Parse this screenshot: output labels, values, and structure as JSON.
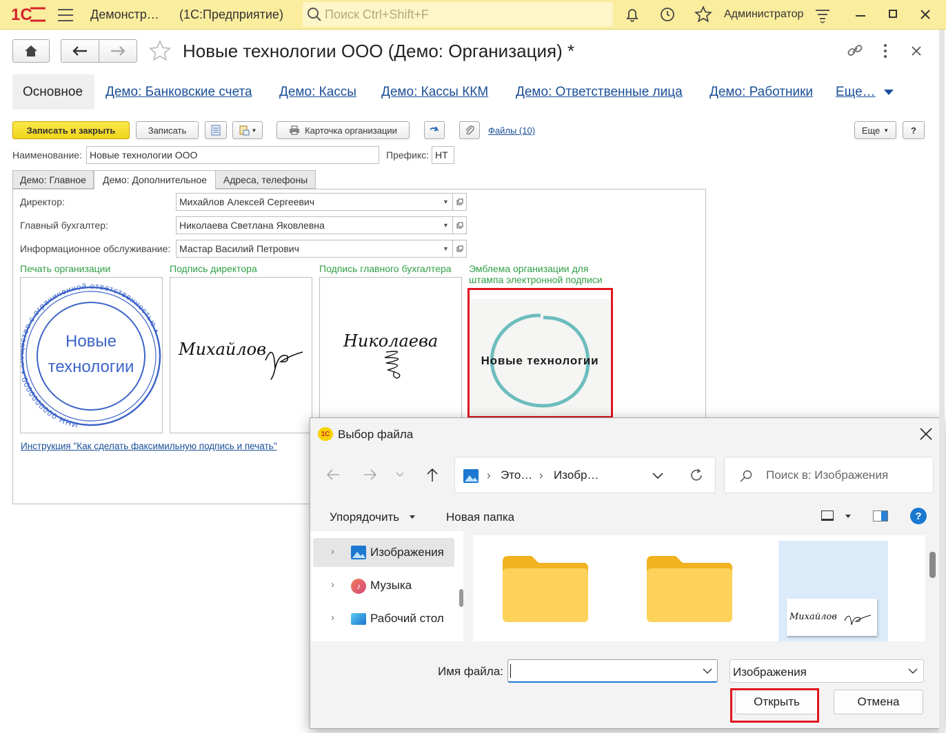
{
  "topbar": {
    "logo": "1С",
    "app_title": "Демонстр…",
    "app_subtitle": "(1С:Предприятие)",
    "search_placeholder": "Поиск Ctrl+Shift+F",
    "user": "Администратор"
  },
  "form": {
    "title": "Новые технологии ООО (Демо: Организация) *",
    "nav_tabs": [
      "Основное",
      "Демо: Банковские счета",
      "Демо: Кассы",
      "Демо: Кассы ККМ",
      "Демо: Ответственные лица",
      "Демо: Работники",
      "Еще…"
    ],
    "toolbar": {
      "save_close": "Записать и закрыть",
      "save": "Записать",
      "card": "Карточка организации",
      "files": "Файлы (10)",
      "more": "Еще",
      "help": "?"
    },
    "name_label": "Наименование:",
    "name_value": "Новые технологии ООО",
    "prefix_label": "Префикс:",
    "prefix_value": "НТ",
    "inner_tabs": [
      "Демо: Главное",
      "Демо: Дополнительное",
      "Адреса, телефоны"
    ],
    "director_label": "Директор:",
    "director_value": "Михайлов Алексей Сергеевич",
    "accountant_label": "Главный бухгалтер:",
    "accountant_value": "Николаева Светлана Яковлевна",
    "info_label": "Информационное обслуживание:",
    "info_value": "Мастар Василий Петрович",
    "seal_label": "Печать организации",
    "director_sign_label": "Подпись директора",
    "accountant_sign_label": "Подпись главного бухгалтера",
    "emblem_label_1": "Эмблема организации для",
    "emblem_label_2": "штампа электронной подписи",
    "seal_text_1": "Новые",
    "seal_text_2": "технологии",
    "seal_ring_text": "ИНН 0000000000 • Общество с ограниченной ответственностью •",
    "director_signature": "Михайлов",
    "accountant_signature": "Николаева",
    "emblem_text": "Новые технологии",
    "instruction_link": "Инструкция \"Как сделать факсимильную подпись и печать\""
  },
  "dialog": {
    "title": "Выбор файла",
    "path_1": "Это…",
    "path_2": "Изобр…",
    "search_placeholder": "Поиск в: Изображения",
    "organize": "Упорядочить",
    "new_folder": "Новая папка",
    "help": "?",
    "tree": [
      "Изображения",
      "Музыка",
      "Рабочий стол"
    ],
    "thumb_signature": "Михайлов",
    "filename_label": "Имя файла:",
    "filename_value": "",
    "filetype": "Изображения",
    "open": "Открыть",
    "cancel": "Отмена"
  },
  "colors": {
    "highlight": "#e0141e",
    "accent_yellow": "#f6de2c",
    "link": "#1a4e96",
    "green_label": "#2f9e45"
  }
}
